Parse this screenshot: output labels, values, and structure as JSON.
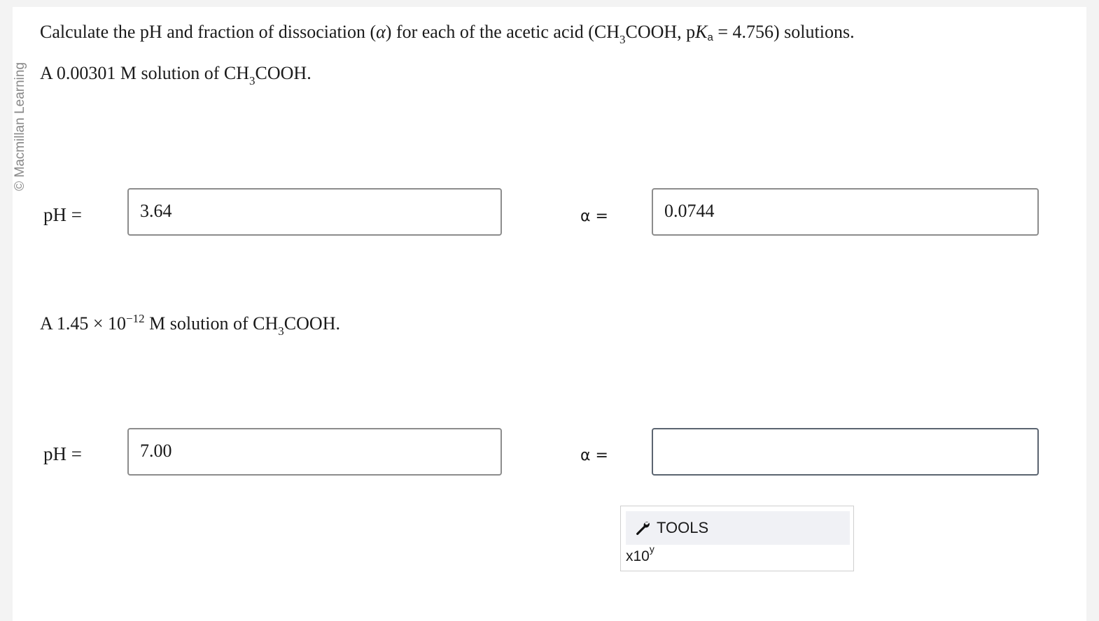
{
  "watermark": "© Macmillan Learning",
  "question": {
    "intro_part1": "Calculate the pH and fraction of dissociation (",
    "alpha": "α",
    "intro_part2": ") for each of the acetic acid (CH",
    "sub3": "3",
    "intro_part3": "COOH, p",
    "k_symbol": "K",
    "k_sub": "a",
    "intro_part4": " = 4.756) solutions."
  },
  "parts": [
    {
      "prompt_part1": "A 0.00301 M solution of CH",
      "prompt_sub": "3",
      "prompt_part2": "COOH.",
      "ph_label": "pH =",
      "ph_value": "3.64",
      "alpha_label": "α =",
      "alpha_value": "0.0744"
    },
    {
      "prompt_part1": "A 1.45 × 10",
      "prompt_sup": "−12",
      "prompt_part2": " M solution of CH",
      "prompt_sub": "3",
      "prompt_part3": "COOH.",
      "ph_label": "pH =",
      "ph_value": "7.00",
      "alpha_label": "α =",
      "alpha_value": ""
    }
  ],
  "tools": {
    "header_label": "TOOLS",
    "icon": "wrench-icon",
    "x10_base": "x10",
    "x10_exp": "y"
  }
}
